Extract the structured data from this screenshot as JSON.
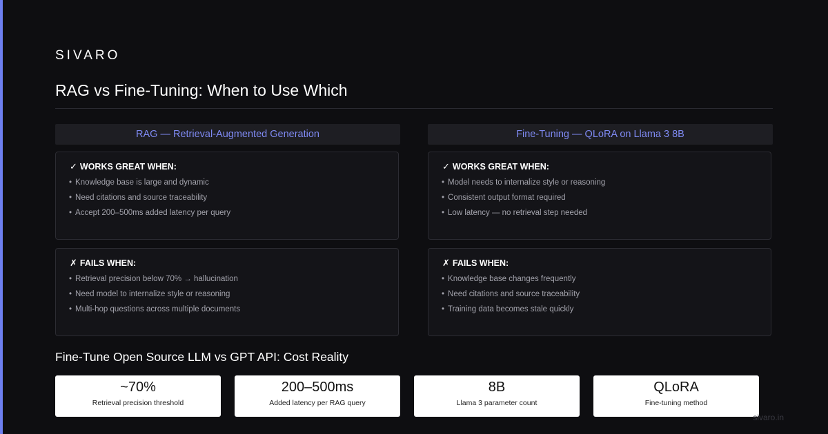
{
  "brand": "SIVARO",
  "title": "RAG vs Fine-Tuning: When to Use Which",
  "columns": [
    {
      "header": "RAG — Retrieval-Augmented Generation",
      "works": {
        "icon": "✓",
        "heading": "WORKS GREAT WHEN:",
        "items": [
          "Knowledge base is large and dynamic",
          "Need citations and source traceability",
          "Accept 200–500ms added latency per query"
        ]
      },
      "fails": {
        "icon": "✗",
        "heading": "FAILS WHEN:",
        "items": [
          "Retrieval precision below 70% → hallucination",
          "Need model to internalize style or reasoning",
          "Multi-hop questions across multiple documents"
        ]
      }
    },
    {
      "header": "Fine-Tuning — QLoRA on Llama 3 8B",
      "works": {
        "icon": "✓",
        "heading": "WORKS GREAT WHEN:",
        "items": [
          "Model needs to internalize style or reasoning",
          "Consistent output format required",
          "Low latency — no retrieval step needed"
        ]
      },
      "fails": {
        "icon": "✗",
        "heading": "FAILS WHEN:",
        "items": [
          "Knowledge base changes frequently",
          "Need citations and source traceability",
          "Training data becomes stale quickly"
        ]
      }
    }
  ],
  "bullet": "•",
  "cost_title": "Fine-Tune Open Source LLM vs GPT API: Cost Reality",
  "stats": [
    {
      "value": "~70%",
      "label": "Retrieval precision threshold"
    },
    {
      "value": "200–500ms",
      "label": "Added latency per RAG query"
    },
    {
      "value": "8B",
      "label": "Llama 3 parameter count"
    },
    {
      "value": "QLoRA",
      "label": "Fine-tuning method"
    }
  ],
  "footer": "sivaro.in",
  "colors": {
    "accent": "#6d7ff0",
    "background": "#0e0e11",
    "header_text": "#7f8af3"
  }
}
